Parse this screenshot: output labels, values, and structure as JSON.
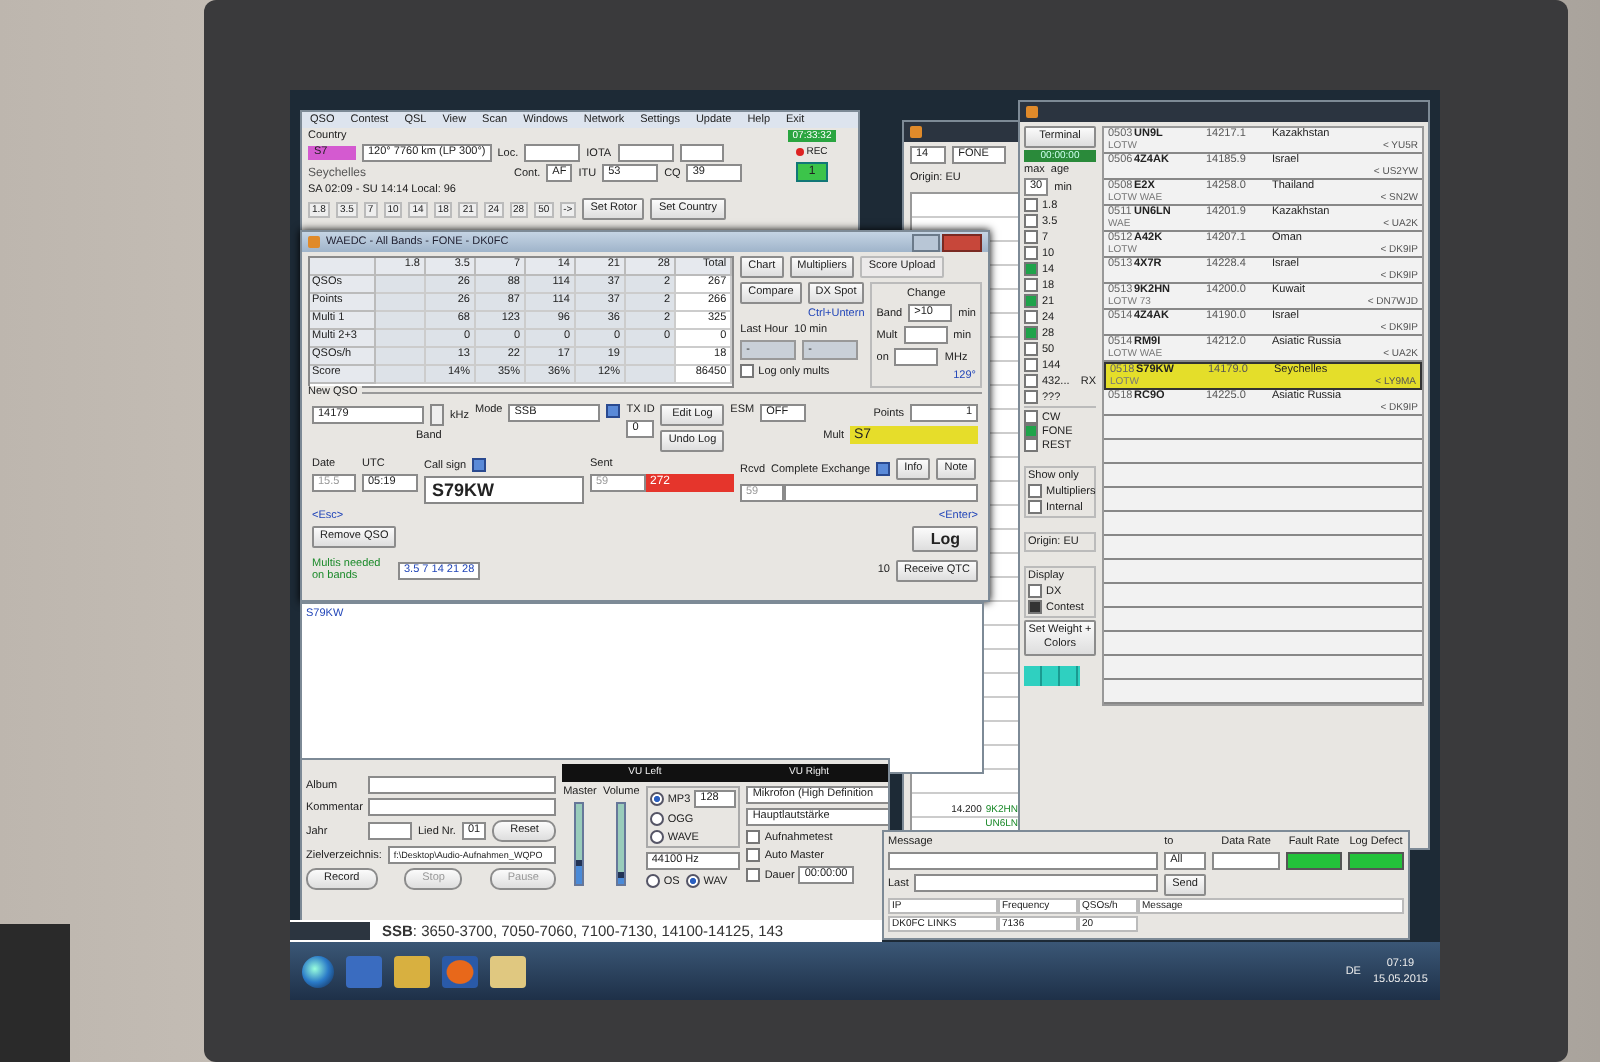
{
  "logger": {
    "menu": [
      "QSO",
      "Contest",
      "QSL",
      "View",
      "Scan",
      "Windows",
      "Network",
      "Settings",
      "Update",
      "Help",
      "Exit"
    ],
    "country_label": "Country",
    "prefix": "S7",
    "bearing": "120° 7760 km (LP 300°)",
    "loc_label": "Loc.",
    "iota_label": "IOTA",
    "country_name": "Seychelles",
    "sun_times": "SA 02:09 - SU 14:14   Local: 96",
    "cont_label": "Cont.",
    "cont": "AF",
    "itu_label": "ITU",
    "itu": "53",
    "cq_label": "CQ",
    "cq": "39",
    "bands": [
      "1.8",
      "3.5",
      "7",
      "10",
      "14",
      "18",
      "21",
      "24",
      "28",
      "50",
      "->"
    ],
    "set_rotor": "Set Rotor",
    "set_country": "Set Country",
    "clock": "07:33:32",
    "rec": "REC",
    "rx": "1"
  },
  "contest": {
    "title": "WAEDC - All Bands - FONE - DK0FC",
    "columns": [
      "",
      "1.8",
      "3.5",
      "7",
      "14",
      "21",
      "28",
      "Total"
    ],
    "rows": [
      [
        "QSOs",
        null,
        "26",
        "88",
        "114",
        "37",
        "2",
        "267"
      ],
      [
        "Points",
        null,
        "26",
        "87",
        "114",
        "37",
        "2",
        "266"
      ],
      [
        "Multi 1",
        null,
        "68",
        "123",
        "96",
        "36",
        "2",
        "325"
      ],
      [
        "Multi 2+3",
        null,
        "0",
        "0",
        "0",
        "0",
        "0",
        "0"
      ],
      [
        "QSOs/h",
        null,
        "13",
        "22",
        "17",
        "19",
        null,
        "18"
      ],
      [
        "Score",
        null,
        "14%",
        "35%",
        "36%",
        "12%",
        null,
        "86450"
      ]
    ],
    "buttons": [
      "Chart",
      "Multipliers",
      "Score Upload",
      "Compare",
      "DX Spot"
    ],
    "shortcut": "Ctrl+Untern",
    "last_hour": "Last Hour",
    "ten_min": "10 min",
    "last_hour_value": "-",
    "ten_min_value": "-",
    "change": {
      "title": "Change",
      "band": "Band",
      "band_value": ">10",
      "min1": "min",
      "mult": "Mult",
      "min2": "min",
      "on": "on",
      "mhz": "MHz"
    },
    "log_only_mults": {
      "label": "Log only mults",
      "checked": false
    },
    "azimuth": "129°",
    "new_qso": {
      "title": "New QSO",
      "freq": "14179",
      "khz": "kHz",
      "band": "Band",
      "mode_label": "Mode",
      "mode": "SSB",
      "txid_label": "TX ID",
      "txid": "0",
      "edit_log": "Edit Log",
      "undo_log": "Undo Log",
      "esm_label": "ESM",
      "esm": "OFF",
      "points_label": "Points",
      "points": "1",
      "mult_label": "Mult",
      "mult": "S7",
      "date_label": "Date",
      "date": "15.5",
      "utc_label": "UTC",
      "utc": "05:19",
      "call_label": "Call sign",
      "call": "S79KW",
      "sent_label": "Sent",
      "sent_rst": "59",
      "sent_nr": "272",
      "rcvd_label": "Rcvd",
      "exchange_label": "Complete Exchange",
      "rcvd_rst": "59",
      "info": "Info",
      "note": "Note",
      "esc": "<Esc>",
      "remove": "Remove QSO",
      "multis_needed": "Multis needed on bands",
      "multi_bands": "3.5 7 14 21 28",
      "qtc_count": "10",
      "receive_qtc": "Receive QTC",
      "enter": "<Enter>",
      "log": "Log"
    }
  },
  "text_pane": {
    "text": "S79KW"
  },
  "recorder": {
    "album": "Album",
    "comment": "Kommentar",
    "year": "Jahr",
    "song_label": "Lied Nr.",
    "song": "01",
    "reset": "Reset",
    "dir_label": "Zielverzeichnis:",
    "dir": "f:\\Desktop\\Audio-Aufnahmen_WQPO",
    "record": "Record",
    "stop": "Stop",
    "pause": "Pause",
    "vu_left": "VU Left",
    "vu_right": "VU Right",
    "master": "Master",
    "volume": "Volume",
    "master_slider": {
      "level": 0.3
    },
    "volume_slider": {
      "level": 0.15
    },
    "formats": [
      {
        "label": "MP3",
        "selected": true
      },
      {
        "label": "OGG",
        "selected": false
      },
      {
        "label": "WAVE",
        "selected": false
      }
    ],
    "bitrate": "128",
    "rate": "44100 Hz",
    "containers": [
      {
        "label": "OS",
        "selected": false
      },
      {
        "label": "WAV",
        "selected": true
      }
    ],
    "device": "Mikrofon (High Definition",
    "mixer": "Hauptlautstärke",
    "options": [
      {
        "label": "Aufnahmetest",
        "checked": false
      },
      {
        "label": "Auto Master",
        "checked": false
      },
      {
        "label": "Dauer",
        "checked": false
      }
    ],
    "duration": "00:00:00"
  },
  "bandmap": {
    "band": "14",
    "mode": "FONE",
    "origin": "Origin: EU",
    "entries": [
      {
        "freq": "14.200",
        "call": "9K2HN"
      },
      {
        "call": "UN6LN"
      }
    ]
  },
  "cluster": {
    "terminal": "Terminal",
    "time": "00:00:00",
    "max_label": "max",
    "age_label": "age",
    "age": "30",
    "min": "min",
    "bands": [
      {
        "label": "1.8",
        "checked": false
      },
      {
        "label": "3.5",
        "checked": false
      },
      {
        "label": "7",
        "checked": false
      },
      {
        "label": "10",
        "checked": false
      },
      {
        "label": "14",
        "checked": true
      },
      {
        "label": "18",
        "checked": false
      },
      {
        "label": "21",
        "checked": true
      },
      {
        "label": "24",
        "checked": false
      },
      {
        "label": "28",
        "checked": true
      },
      {
        "label": "50",
        "checked": false
      },
      {
        "label": "144",
        "checked": false
      },
      {
        "label": "432...",
        "checked": false
      },
      {
        "label": "???",
        "checked": false
      }
    ],
    "rx": "RX",
    "modes": [
      {
        "label": "CW",
        "checked": false
      },
      {
        "label": "FONE",
        "checked": true
      },
      {
        "label": "REST",
        "checked": false
      }
    ],
    "spots": [
      {
        "time": "0503",
        "call": "UN9L",
        "freq": "14217.1",
        "country": "Kazakhstan",
        "note": "LOTW",
        "spotter": "< YU5R",
        "selected": false
      },
      {
        "time": "0506",
        "call": "4Z4AK",
        "freq": "14185.9",
        "country": "Israel",
        "spotter": "< US2YW",
        "selected": false
      },
      {
        "time": "0508",
        "call": "E2X",
        "freq": "14258.0",
        "country": "Thailand",
        "note": "LOTW WAE",
        "spotter": "< SN2W",
        "selected": false
      },
      {
        "time": "0511",
        "call": "UN6LN",
        "freq": "14201.9",
        "country": "Kazakhstan",
        "note": "WAE",
        "spotter": "< UA2K",
        "selected": false
      },
      {
        "time": "0512",
        "call": "A42K",
        "freq": "14207.1",
        "country": "Oman",
        "note": "LOTW",
        "spotter": "< DK9IP",
        "selected": false
      },
      {
        "time": "0513",
        "call": "4X7R",
        "freq": "14228.4",
        "country": "Israel",
        "spotter": "< DK9IP",
        "selected": false
      },
      {
        "time": "0513",
        "call": "9K2HN",
        "freq": "14200.0",
        "country": "Kuwait",
        "note": "LOTW 73",
        "spotter": "< DN7WJD",
        "selected": false
      },
      {
        "time": "0514",
        "call": "4Z4AK",
        "freq": "14190.0",
        "country": "Israel",
        "spotter": "< DK9IP",
        "selected": false
      },
      {
        "time": "0514",
        "call": "RM9I",
        "freq": "14212.0",
        "country": "Asiatic Russia",
        "note": "LOTW WAE",
        "spotter": "< UA2K",
        "selected": false
      },
      {
        "time": "0518",
        "call": "S79KW",
        "freq": "14179.0",
        "country": "Seychelles",
        "note": "LOTW",
        "spotter": "< LY9MA",
        "selected": true
      },
      {
        "time": "0518",
        "call": "RC9O",
        "freq": "14225.0",
        "country": "Asiatic Russia",
        "spotter": "< DK9IP",
        "selected": false
      }
    ],
    "show_only": "Show only",
    "filters": [
      {
        "label": "Multipliers",
        "checked": false
      },
      {
        "label": "Internal",
        "checked": false
      }
    ],
    "origin": "Origin: EU",
    "display": "Display",
    "display_modes": [
      {
        "label": "DX",
        "selected": false
      },
      {
        "label": "Contest",
        "selected": true
      }
    ],
    "weight": "Set Weight + Colors"
  },
  "network": {
    "message": "Message",
    "to": "to",
    "to_value": "All",
    "send": "Send",
    "last": "Last",
    "data_rate": "Data Rate",
    "fault_rate": "Fault Rate",
    "log_defect": "Log Defect",
    "columns": [
      "IP",
      "Frequency",
      "QSOs/h",
      "Message"
    ],
    "rows": [
      [
        "DK0FC LINKS",
        "7136",
        "20"
      ]
    ]
  },
  "band_plan": "**SSB**: 3650-3700, 7050-7060, 7100-7130, 14100-14125, 143",
  "tray": {
    "lang": "DE",
    "time": "07:19",
    "date": "15.05.2015"
  }
}
